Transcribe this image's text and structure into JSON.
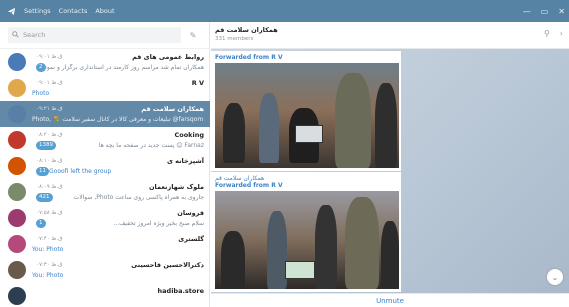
{
  "menu": {
    "settings": "Settings",
    "contacts": "Contacts",
    "about": "About"
  },
  "window_controls": {
    "minimize": "—",
    "maximize": "▭",
    "close": "✕"
  },
  "search": {
    "placeholder": "Search"
  },
  "chats": [
    {
      "name": "روابط عمومی های قم",
      "time": "۰۹:۰۱ ق.ظ",
      "msg": "همکاران تمام شد مراسم روز کارمند در استانداری برگزار و نمونه ها",
      "badge": "2",
      "avatar_color": "#4a7bb7",
      "avatar_text": "",
      "msg_blue": false
    },
    {
      "name": "R V",
      "time": "۰۹:۰۱ ق.ظ",
      "msg": "Photo",
      "badge": "",
      "avatar_color": "#e0a84d",
      "avatar_text": "",
      "msg_blue": true
    },
    {
      "name": "همکاران سلامت قم",
      "time": "۰۹:۲۱ ق.ظ",
      "msg": "Photo, 💐 تبلیغات و معرفی کالا در کانال سفیر سلامت @farsqom",
      "badge": "",
      "avatar_color": "#5a7fa6",
      "avatar_text": "",
      "msg_blue": true
    },
    {
      "name": "Cooking",
      "time": "۰۸:۲۰ ق.ظ",
      "msg": "Farnaz 😊 پست جدید در صفحه ما بچه ها",
      "badge": "1389",
      "avatar_color": "#c0392b",
      "avatar_text": "",
      "msg_blue": false
    },
    {
      "name": "آشپزخانه ی",
      "time": "۰۸:۱۰ ق.ظ",
      "msg": "Gooofi left the group",
      "badge": "11",
      "avatar_color": "#d35400",
      "avatar_text": "",
      "msg_blue": true
    },
    {
      "name": "ملوک شهازنعمان",
      "time": "۰۸:۰۹ ق.ظ",
      "msg": "جاروی به همراه پاکسی روی ساعت Photo, سوالات",
      "badge": "421",
      "avatar_color": "#7a8b6a",
      "avatar_text": "",
      "msg_blue": false
    },
    {
      "name": "قروسان",
      "time": "۰۷:۵۸ ق.ظ",
      "msg": "سلام صبح بخیر ویژه امروز تخفیف...",
      "badge": "1",
      "avatar_color": "#9b3b6e",
      "avatar_text": "",
      "msg_blue": false
    },
    {
      "name": "گلستری",
      "time": "۰۷:۴۰ ق.ظ",
      "msg": "You: Photo",
      "badge": "",
      "avatar_color": "#b34a7a",
      "avatar_text": "",
      "msg_blue": true
    },
    {
      "name": "دکترالاحسین قاحسینی",
      "time": "۰۷:۳۰ ق.ظ",
      "msg": "You: Photo",
      "badge": "",
      "avatar_color": "#6b5a4a",
      "avatar_text": "",
      "msg_blue": true
    },
    {
      "name": "hadiba.store",
      "time": "",
      "msg": "",
      "badge": "",
      "avatar_color": "#2c3e50",
      "avatar_text": "",
      "msg_blue": false
    }
  ],
  "conversation": {
    "title": "همکاران سلامت قم",
    "subtitle": "331 members",
    "posts": [
      {
        "title": "",
        "forwarded": "Forwarded from R V"
      },
      {
        "title": "همکاران سلامت قم",
        "forwarded": "Forwarded from R V"
      }
    ],
    "unmute_label": "Unmute"
  }
}
